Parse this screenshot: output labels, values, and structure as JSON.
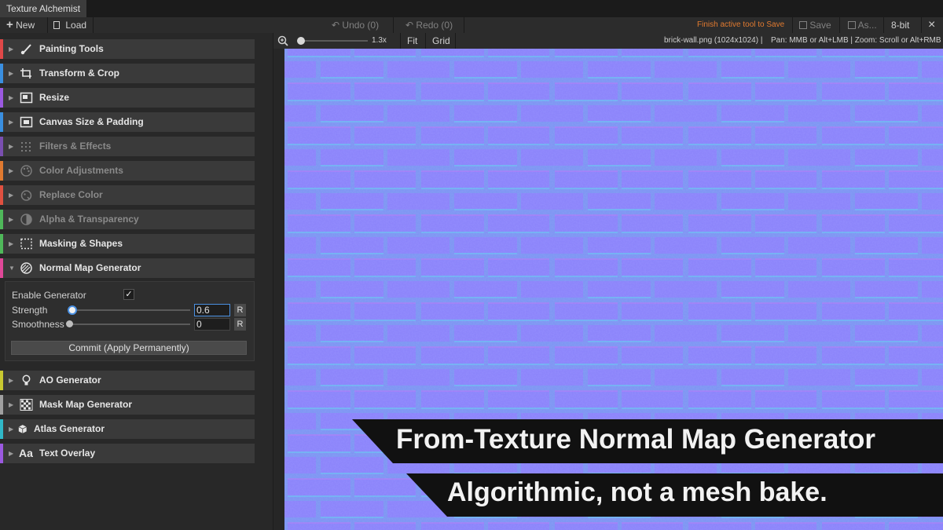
{
  "app": {
    "title": "Texture Alchemist"
  },
  "toolbar": {
    "new_label": "New",
    "load_label": "Load",
    "undo_label": "Undo (0)",
    "redo_label": "Redo (0)",
    "finish_hint": "Finish active tool to Save",
    "save_label": "Save",
    "save_as_label": "As...",
    "bit_depth": "8-bit",
    "close_label": "×"
  },
  "zoombar": {
    "zoom_value": "1.3x",
    "zoom_fraction": 0.05,
    "fit_label": "Fit",
    "grid_label": "Grid",
    "file_info": "brick-wall.png (1024x1024)  |",
    "pan_hint": "Pan: MMB or Alt+LMB | Zoom: Scroll or Alt+RMB"
  },
  "sidebar": {
    "items": [
      {
        "label": "Painting Tools",
        "color": "#e04848",
        "icon": "brush-icon"
      },
      {
        "label": "Transform & Crop",
        "color": "#3a8fe0",
        "icon": "crop-icon"
      },
      {
        "label": "Resize",
        "color": "#9b59e0",
        "icon": "resize-icon"
      },
      {
        "label": "Canvas Size & Padding",
        "color": "#3a8fe0",
        "icon": "canvas-icon"
      },
      {
        "label": "Filters & Effects",
        "color": "#7a4fb0",
        "icon": "filter-icon"
      },
      {
        "label": "Color Adjustments",
        "color": "#e07a30",
        "icon": "palette-icon"
      },
      {
        "label": "Replace Color",
        "color": "#e05040",
        "icon": "replace-color-icon"
      },
      {
        "label": "Alpha & Transparency",
        "color": "#4fb85a",
        "icon": "alpha-icon"
      },
      {
        "label": "Masking & Shapes",
        "color": "#4fb85a",
        "icon": "mask-icon"
      },
      {
        "label": "Normal Map Generator",
        "color": "#e04898",
        "icon": "normal-map-icon"
      },
      {
        "label": "AO Generator",
        "color": "#c8c830",
        "icon": "bulb-icon"
      },
      {
        "label": "Mask Map Generator",
        "color": "#a0a0a0",
        "icon": "checker-icon"
      },
      {
        "label": "Atlas Generator",
        "color": "#30b8c8",
        "icon": "cube-icon"
      },
      {
        "label": "Text Overlay",
        "color": "#9b59e0",
        "icon": "text-icon"
      }
    ]
  },
  "normal_panel": {
    "enable_label": "Enable Generator",
    "enabled": true,
    "strength_label": "Strength",
    "strength_value": "0.6",
    "smoothness_label": "Smoothness",
    "smoothness_value": "0",
    "reset_label": "R",
    "commit_label": "Commit (Apply Permanently)"
  },
  "banners": {
    "headline": "From-Texture Normal Map Generator",
    "subline": "Algorithmic, not a mesh bake."
  },
  "colors": {
    "normal_map": "#8a80ff",
    "mortar": "#7a9cf4",
    "accent_orange": "#e07a30"
  }
}
